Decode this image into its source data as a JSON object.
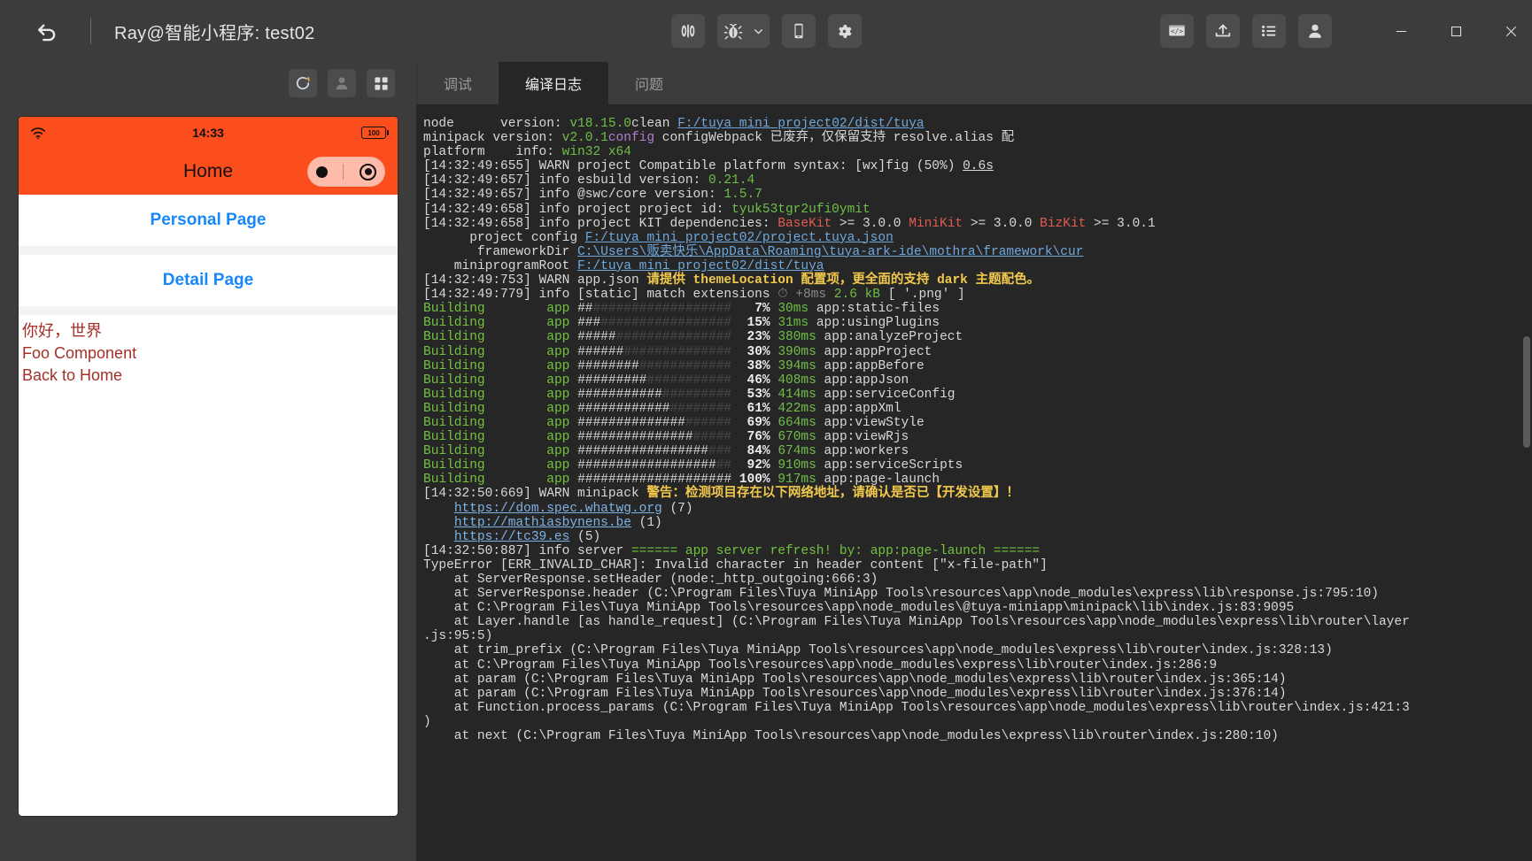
{
  "titlebar": {
    "back_icon": "undo-arrow-icon",
    "title": "Ray@智能小程序: test02",
    "center_buttons": [
      {
        "name": "preview-toggle-button",
        "icon": "split-view-icon"
      },
      {
        "name": "debug-button",
        "icon": "bug-icon"
      },
      {
        "name": "debug-dropdown-button",
        "icon": "chevron-down-icon"
      },
      {
        "name": "device-preview-button",
        "icon": "mobile-phone-icon"
      },
      {
        "name": "settings-button",
        "icon": "gear-icon"
      }
    ],
    "right_buttons": [
      {
        "name": "code-view-button",
        "icon": "code-window-icon"
      },
      {
        "name": "upload-button",
        "icon": "upload-tray-icon"
      },
      {
        "name": "list-menu-button",
        "icon": "bullet-list-icon"
      },
      {
        "name": "account-button",
        "icon": "user-avatar-icon"
      }
    ],
    "window_controls": [
      {
        "name": "minimize-button",
        "icon": "minimize-icon",
        "glyph": "—"
      },
      {
        "name": "maximize-button",
        "icon": "maximize-square-icon",
        "glyph": "□"
      },
      {
        "name": "close-button",
        "icon": "close-x-icon",
        "glyph": "✕"
      }
    ]
  },
  "simulator": {
    "toolbar": [
      {
        "name": "refresh-button",
        "icon": "refresh-circular-arrow-icon"
      },
      {
        "name": "user-profile-button",
        "icon": "user-silhouette-icon"
      },
      {
        "name": "apps-grid-button",
        "icon": "grid-squares-icon"
      }
    ],
    "phone": {
      "status_bar": {
        "wifi_icon": "wifi-signal-icon",
        "time": "14:33",
        "battery_level": "100",
        "battery_icon": "battery-full-icon"
      },
      "nav_title": "Home",
      "capsule": {
        "dot_icon": "more-dot-icon",
        "target_icon": "close-target-icon"
      },
      "cells": [
        {
          "label": "Personal Page"
        },
        {
          "label": "Detail Page"
        }
      ],
      "content_lines": [
        "你好，世界",
        "Foo Component",
        "Back to Home"
      ]
    }
  },
  "console": {
    "tabs": [
      {
        "label": "调试",
        "active": false
      },
      {
        "label": "编译日志",
        "active": true
      },
      {
        "label": "问题",
        "active": false
      }
    ],
    "log": [
      [
        {
          "t": "node      version: ",
          "c": ""
        },
        {
          "t": "v18.15.0",
          "c": "c-green"
        },
        {
          "t": "clean ",
          "c": ""
        },
        {
          "t": "F:/tuya mini project02/dist/tuya",
          "c": "c-link"
        }
      ],
      [
        {
          "t": "minipack version: ",
          "c": ""
        },
        {
          "t": "v2.0.1",
          "c": "c-green"
        },
        {
          "t": "config",
          "c": "c-purple"
        },
        {
          "t": " configWebpack 已废弃，仅保留支持 resolve.alias 配",
          "c": ""
        }
      ],
      [
        {
          "t": "platform    info: ",
          "c": ""
        },
        {
          "t": "win32 x64",
          "c": "c-green"
        }
      ],
      [
        {
          "t": "[14:32:49:655] WARN project Compatible platform syntax: [wx]fig (50%) ",
          "c": ""
        },
        {
          "t": "0.6s",
          "c": "c-ul"
        }
      ],
      [
        {
          "t": "[14:32:49:657] info esbuild version: ",
          "c": ""
        },
        {
          "t": "0.21.4",
          "c": "c-green"
        }
      ],
      [
        {
          "t": "[14:32:49:657] info @swc/core version: ",
          "c": ""
        },
        {
          "t": "1.5.7",
          "c": "c-green"
        }
      ],
      [
        {
          "t": "[14:32:49:658] info project project id: ",
          "c": ""
        },
        {
          "t": "tyuk53tgr2ufi0ymit",
          "c": "c-green"
        }
      ],
      [
        {
          "t": "[14:32:49:658] info project KIT dependencies: ",
          "c": ""
        },
        {
          "t": "BaseKit",
          "c": "c-red"
        },
        {
          "t": " >= 3.0.0 ",
          "c": ""
        },
        {
          "t": "MiniKit",
          "c": "c-red"
        },
        {
          "t": " >= 3.0.0 ",
          "c": ""
        },
        {
          "t": "BizKit",
          "c": "c-red"
        },
        {
          "t": " >= 3.0.1",
          "c": ""
        }
      ],
      [
        {
          "t": "      project config ",
          "c": ""
        },
        {
          "t": "F:/tuya mini project02/project.tuya.json",
          "c": "c-link"
        }
      ],
      [
        {
          "t": "       frameworkDir ",
          "c": ""
        },
        {
          "t": "C:\\Users\\贩卖快乐\\AppData\\Roaming\\tuya-ark-ide\\mothra\\framework\\cur",
          "c": "c-link"
        }
      ],
      [
        {
          "t": "    miniprogramRoot ",
          "c": ""
        },
        {
          "t": "F:/tuya mini project02/dist/tuya",
          "c": "c-link"
        }
      ],
      [
        {
          "t": "[14:32:49:753] WARN app.json ",
          "c": ""
        },
        {
          "t": "请提供 themeLocation 配置项，更全面的支持 dark 主题配色。",
          "c": "c-yellow"
        }
      ],
      [
        {
          "t": "[14:32:49:779] info [static] match extensions ",
          "c": ""
        },
        {
          "t": "⏱",
          "c": "c-gray"
        },
        {
          "t": " +8ms ",
          "c": "c-gray"
        },
        {
          "t": "2.6 kB",
          "c": "c-green"
        },
        {
          "t": " [ '.png' ]",
          "c": ""
        }
      ],
      [
        {
          "t": "Building",
          "c": "c-green2"
        },
        {
          "t": "        ",
          "c": ""
        },
        {
          "t": "app",
          "c": "c-green2"
        },
        {
          "t": " ",
          "c": ""
        },
        {
          "t": "##",
          "c": "c-hash"
        },
        {
          "t": "##################",
          "c": "c-hashdim"
        },
        {
          "t": "   7%",
          "c": "c-pct"
        },
        {
          "t": " 30ms",
          "c": "c-ms"
        },
        {
          "t": " app:static-files",
          "c": ""
        }
      ],
      [
        {
          "t": "Building",
          "c": "c-green2"
        },
        {
          "t": "        ",
          "c": ""
        },
        {
          "t": "app",
          "c": "c-green2"
        },
        {
          "t": " ",
          "c": ""
        },
        {
          "t": "###",
          "c": "c-hash"
        },
        {
          "t": "#################",
          "c": "c-hashdim"
        },
        {
          "t": "  15%",
          "c": "c-pct"
        },
        {
          "t": " 31ms",
          "c": "c-ms"
        },
        {
          "t": " app:usingPlugins",
          "c": ""
        }
      ],
      [
        {
          "t": "Building",
          "c": "c-green2"
        },
        {
          "t": "        ",
          "c": ""
        },
        {
          "t": "app",
          "c": "c-green2"
        },
        {
          "t": " ",
          "c": ""
        },
        {
          "t": "#####",
          "c": "c-hash"
        },
        {
          "t": "###############",
          "c": "c-hashdim"
        },
        {
          "t": "  23%",
          "c": "c-pct"
        },
        {
          "t": " 380ms",
          "c": "c-ms"
        },
        {
          "t": " app:analyzeProject",
          "c": ""
        }
      ],
      [
        {
          "t": "Building",
          "c": "c-green2"
        },
        {
          "t": "        ",
          "c": ""
        },
        {
          "t": "app",
          "c": "c-green2"
        },
        {
          "t": " ",
          "c": ""
        },
        {
          "t": "######",
          "c": "c-hash"
        },
        {
          "t": "##############",
          "c": "c-hashdim"
        },
        {
          "t": "  30%",
          "c": "c-pct"
        },
        {
          "t": " 390ms",
          "c": "c-ms"
        },
        {
          "t": " app:appProject",
          "c": ""
        }
      ],
      [
        {
          "t": "Building",
          "c": "c-green2"
        },
        {
          "t": "        ",
          "c": ""
        },
        {
          "t": "app",
          "c": "c-green2"
        },
        {
          "t": " ",
          "c": ""
        },
        {
          "t": "########",
          "c": "c-hash"
        },
        {
          "t": "############",
          "c": "c-hashdim"
        },
        {
          "t": "  38%",
          "c": "c-pct"
        },
        {
          "t": " 394ms",
          "c": "c-ms"
        },
        {
          "t": " app:appBefore",
          "c": ""
        }
      ],
      [
        {
          "t": "Building",
          "c": "c-green2"
        },
        {
          "t": "        ",
          "c": ""
        },
        {
          "t": "app",
          "c": "c-green2"
        },
        {
          "t": " ",
          "c": ""
        },
        {
          "t": "#########",
          "c": "c-hash"
        },
        {
          "t": "###########",
          "c": "c-hashdim"
        },
        {
          "t": "  46%",
          "c": "c-pct"
        },
        {
          "t": " 408ms",
          "c": "c-ms"
        },
        {
          "t": " app:appJson",
          "c": ""
        }
      ],
      [
        {
          "t": "Building",
          "c": "c-green2"
        },
        {
          "t": "        ",
          "c": ""
        },
        {
          "t": "app",
          "c": "c-green2"
        },
        {
          "t": " ",
          "c": ""
        },
        {
          "t": "###########",
          "c": "c-hash"
        },
        {
          "t": "#########",
          "c": "c-hashdim"
        },
        {
          "t": "  53%",
          "c": "c-pct"
        },
        {
          "t": " 414ms",
          "c": "c-ms"
        },
        {
          "t": " app:serviceConfig",
          "c": ""
        }
      ],
      [
        {
          "t": "Building",
          "c": "c-green2"
        },
        {
          "t": "        ",
          "c": ""
        },
        {
          "t": "app",
          "c": "c-green2"
        },
        {
          "t": " ",
          "c": ""
        },
        {
          "t": "############",
          "c": "c-hash"
        },
        {
          "t": "########",
          "c": "c-hashdim"
        },
        {
          "t": "  61%",
          "c": "c-pct"
        },
        {
          "t": " 422ms",
          "c": "c-ms"
        },
        {
          "t": " app:appXml",
          "c": ""
        }
      ],
      [
        {
          "t": "Building",
          "c": "c-green2"
        },
        {
          "t": "        ",
          "c": ""
        },
        {
          "t": "app",
          "c": "c-green2"
        },
        {
          "t": " ",
          "c": ""
        },
        {
          "t": "##############",
          "c": "c-hash"
        },
        {
          "t": "######",
          "c": "c-hashdim"
        },
        {
          "t": "  69%",
          "c": "c-pct"
        },
        {
          "t": " 664ms",
          "c": "c-ms"
        },
        {
          "t": " app:viewStyle",
          "c": ""
        }
      ],
      [
        {
          "t": "Building",
          "c": "c-green2"
        },
        {
          "t": "        ",
          "c": ""
        },
        {
          "t": "app",
          "c": "c-green2"
        },
        {
          "t": " ",
          "c": ""
        },
        {
          "t": "###############",
          "c": "c-hash"
        },
        {
          "t": "#####",
          "c": "c-hashdim"
        },
        {
          "t": "  76%",
          "c": "c-pct"
        },
        {
          "t": " 670ms",
          "c": "c-ms"
        },
        {
          "t": " app:viewRjs",
          "c": ""
        }
      ],
      [
        {
          "t": "Building",
          "c": "c-green2"
        },
        {
          "t": "        ",
          "c": ""
        },
        {
          "t": "app",
          "c": "c-green2"
        },
        {
          "t": " ",
          "c": ""
        },
        {
          "t": "#################",
          "c": "c-hash"
        },
        {
          "t": "###",
          "c": "c-hashdim"
        },
        {
          "t": "  84%",
          "c": "c-pct"
        },
        {
          "t": " 674ms",
          "c": "c-ms"
        },
        {
          "t": " app:workers",
          "c": ""
        }
      ],
      [
        {
          "t": "Building",
          "c": "c-green2"
        },
        {
          "t": "        ",
          "c": ""
        },
        {
          "t": "app",
          "c": "c-green2"
        },
        {
          "t": " ",
          "c": ""
        },
        {
          "t": "##################",
          "c": "c-hash"
        },
        {
          "t": "##",
          "c": "c-hashdim"
        },
        {
          "t": "  92%",
          "c": "c-pct"
        },
        {
          "t": " 910ms",
          "c": "c-ms"
        },
        {
          "t": " app:serviceScripts",
          "c": ""
        }
      ],
      [
        {
          "t": "Building",
          "c": "c-green2"
        },
        {
          "t": "        ",
          "c": ""
        },
        {
          "t": "app",
          "c": "c-green2"
        },
        {
          "t": " ",
          "c": ""
        },
        {
          "t": "####################",
          "c": "c-hash"
        },
        {
          "t": " 100%",
          "c": "c-pct"
        },
        {
          "t": " 917ms",
          "c": "c-ms"
        },
        {
          "t": " app:page-launch",
          "c": ""
        }
      ],
      [
        {
          "t": "[14:32:50:669] WARN minipack ",
          "c": ""
        },
        {
          "t": "警告：检测项目存在以下网络地址，请确认是否已【开发设置】！",
          "c": "c-yellow"
        }
      ],
      [
        {
          "t": "    ",
          "c": ""
        },
        {
          "t": "https://dom.spec.whatwg.org",
          "c": "c-link2"
        },
        {
          "t": " (7)",
          "c": ""
        }
      ],
      [
        {
          "t": "    ",
          "c": ""
        },
        {
          "t": "http://mathiasbynens.be",
          "c": "c-link2"
        },
        {
          "t": " (1)",
          "c": ""
        }
      ],
      [
        {
          "t": "    ",
          "c": ""
        },
        {
          "t": "https://tc39.es",
          "c": "c-link2"
        },
        {
          "t": " (5)",
          "c": ""
        }
      ],
      [
        {
          "t": "[14:32:50:887] info server ",
          "c": ""
        },
        {
          "t": "====== app server refresh! by: app:page-launch ======",
          "c": "c-green2"
        }
      ],
      [
        {
          "t": "TypeError [ERR_INVALID_CHAR]: Invalid character in header content [\"x-file-path\"]",
          "c": ""
        }
      ],
      [
        {
          "t": "    at ServerResponse.setHeader (node:_http_outgoing:666:3)",
          "c": ""
        }
      ],
      [
        {
          "t": "    at ServerResponse.header (C:\\Program Files\\Tuya MiniApp Tools\\resources\\app\\node_modules\\express\\lib\\response.js:795:10)",
          "c": ""
        }
      ],
      [
        {
          "t": "    at C:\\Program Files\\Tuya MiniApp Tools\\resources\\app\\node_modules\\@tuya-miniapp\\minipack\\lib\\index.js:83:9095",
          "c": ""
        }
      ],
      [
        {
          "t": "    at Layer.handle [as handle_request] (C:\\Program Files\\Tuya MiniApp Tools\\resources\\app\\node_modules\\express\\lib\\router\\layer",
          "c": ""
        }
      ],
      [
        {
          "t": ".js:95:5)",
          "c": ""
        }
      ],
      [
        {
          "t": "    at trim_prefix (C:\\Program Files\\Tuya MiniApp Tools\\resources\\app\\node_modules\\express\\lib\\router\\index.js:328:13)",
          "c": ""
        }
      ],
      [
        {
          "t": "    at C:\\Program Files\\Tuya MiniApp Tools\\resources\\app\\node_modules\\express\\lib\\router\\index.js:286:9",
          "c": ""
        }
      ],
      [
        {
          "t": "    at param (C:\\Program Files\\Tuya MiniApp Tools\\resources\\app\\node_modules\\express\\lib\\router\\index.js:365:14)",
          "c": ""
        }
      ],
      [
        {
          "t": "    at param (C:\\Program Files\\Tuya MiniApp Tools\\resources\\app\\node_modules\\express\\lib\\router\\index.js:376:14)",
          "c": ""
        }
      ],
      [
        {
          "t": "    at Function.process_params (C:\\Program Files\\Tuya MiniApp Tools\\resources\\app\\node_modules\\express\\lib\\router\\index.js:421:3",
          "c": ""
        }
      ],
      [
        {
          "t": ")",
          "c": ""
        }
      ],
      [
        {
          "t": "    at next (C:\\Program Files\\Tuya MiniApp Tools\\resources\\app\\node_modules\\express\\lib\\router\\index.js:280:10)",
          "c": ""
        }
      ]
    ]
  },
  "colors": {
    "window_bg": "#3c3c3c",
    "console_bg": "#262626",
    "accent_orange": "#fc4d1d",
    "link_blue": "#1787fb",
    "warn_yellow": "#f2c94c",
    "ok_green": "#6fbf47"
  }
}
